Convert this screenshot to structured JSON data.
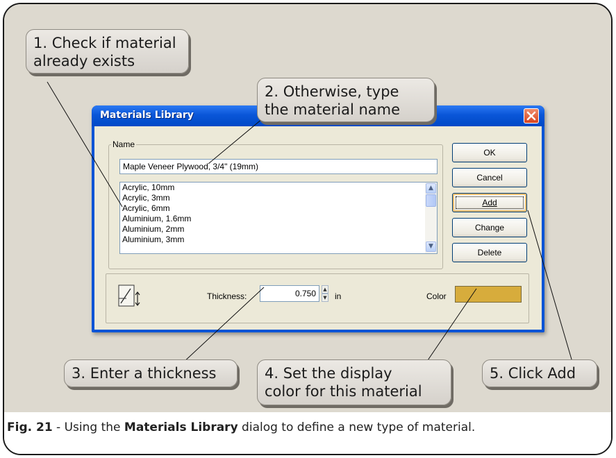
{
  "dialog": {
    "title": "Materials Library",
    "name_group_label": "Name",
    "name_value": "Maple Veneer Plywood, 3/4\" (19mm)",
    "list_items": [
      "Acrylic, 10mm",
      "Acrylic, 3mm",
      "Acrylic, 6mm",
      "Aluminium, 1.6mm",
      "Aluminium, 2mm",
      "Aluminium, 3mm"
    ],
    "buttons": {
      "ok": "OK",
      "cancel": "Cancel",
      "add": "Add",
      "change": "Change",
      "delete": "Delete"
    },
    "thickness_label": "Thickness:",
    "thickness_value": "0.750",
    "thickness_unit": "in",
    "color_label": "Color",
    "color_value": "#d7ac3c"
  },
  "callouts": {
    "c1": "1. Check if material\nalready exists",
    "c2": "2. Otherwise, type\nthe material name",
    "c3": "3. Enter a thickness",
    "c4": "4. Set the display\ncolor for this material",
    "c5": "5. Click Add"
  },
  "caption": {
    "label": "Fig. 21",
    "text_before": " - Using the ",
    "bold": "Materials Library",
    "text_after": " dialog to define a new type of material."
  },
  "icons": [
    "close-icon",
    "thickness-icon",
    "scroll-up-icon",
    "scroll-down-icon",
    "spin-up-icon",
    "spin-down-icon"
  ]
}
